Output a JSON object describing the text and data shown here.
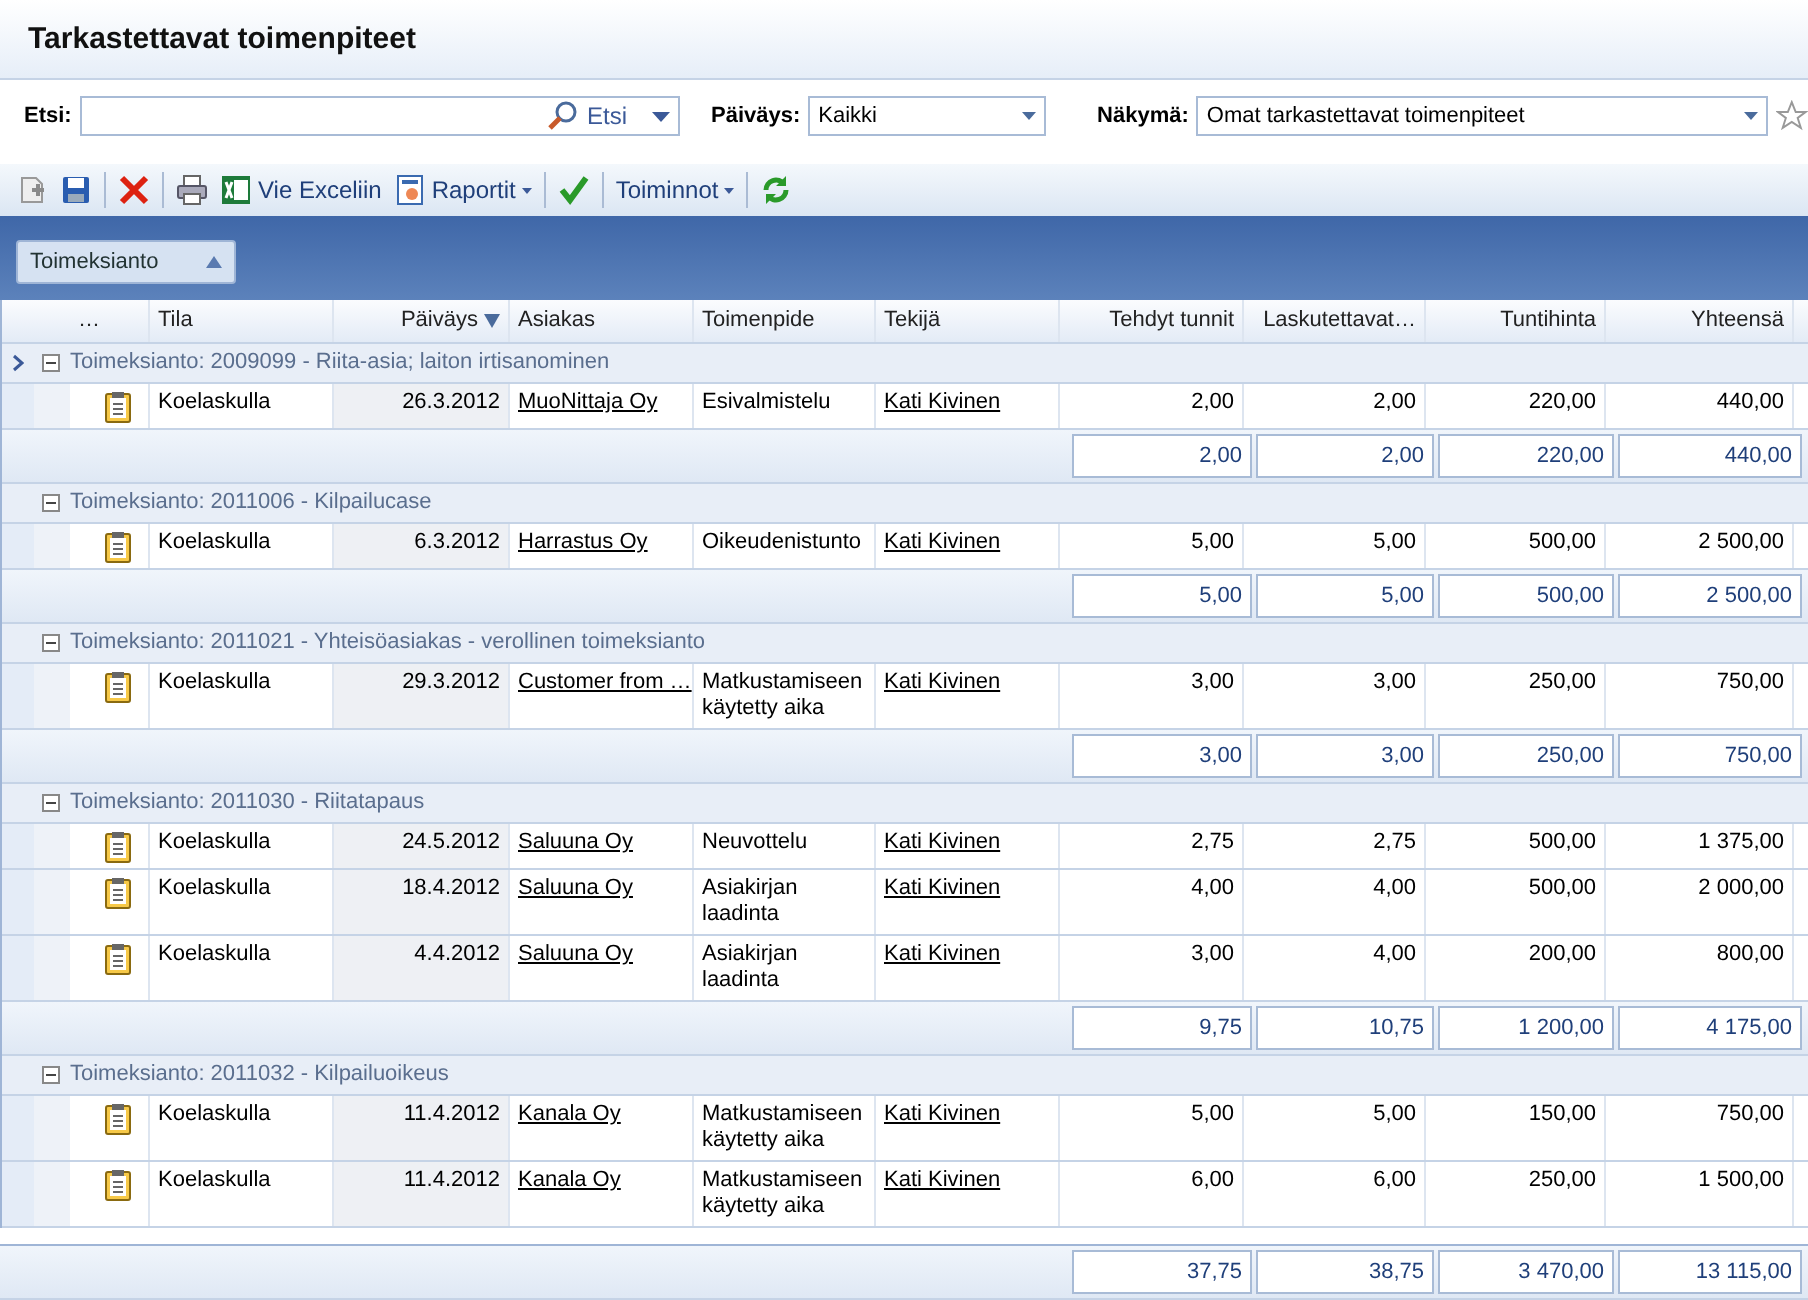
{
  "window": {
    "title": "Tarkastettavat toimenpiteet"
  },
  "filters": {
    "search": {
      "label": "Etsi:",
      "button": "Etsi"
    },
    "date": {
      "label": "Päiväys:",
      "value": "Kaikki"
    },
    "view": {
      "label": "Näkymä:",
      "value": "Omat tarkastettavat toimenpiteet"
    }
  },
  "toolbar": [
    {
      "kind": "add"
    },
    {
      "kind": "save"
    },
    {
      "kind": "separator"
    },
    {
      "kind": "delete"
    },
    {
      "kind": "separator"
    },
    {
      "kind": "print"
    },
    {
      "kind": "export",
      "label": "Vie Exceliin"
    },
    {
      "kind": "report",
      "label": "Raportit"
    },
    {
      "kind": "separator"
    },
    {
      "kind": "approve"
    },
    {
      "kind": "separator"
    },
    {
      "kind": "actions",
      "label": "Toiminnot"
    },
    {
      "kind": "separator"
    },
    {
      "kind": "refresh"
    }
  ],
  "group_panel": {
    "label": "Toimeksianto"
  },
  "table": {
    "columns": [
      {
        "label": "…"
      },
      {
        "label": "Tila"
      },
      {
        "label": "Päiväys",
        "sorted": true
      },
      {
        "label": "Asiakas"
      },
      {
        "label": "Toimenpide"
      },
      {
        "label": "Tekijä"
      },
      {
        "label": "Tehdyt tunnit"
      },
      {
        "label": "Laskutettavat…"
      },
      {
        "label": "Tuntihinta"
      },
      {
        "label": "Yhteensä"
      }
    ],
    "groups": [
      {
        "title": "Toimeksianto: 2009099 - Riita-asia; laiton irtisanominen",
        "expanded": true,
        "selected": true,
        "rows": [
          {
            "status": "Koelaskulla",
            "date": "26.3.2012",
            "customer": "MuoNittaja Oy",
            "action": "Esivalmistelu",
            "author": "Kati Kivinen",
            "hours": "2,00",
            "billable": "2,00",
            "rate": "220,00",
            "total": "440,00"
          }
        ],
        "summary": [
          "2,00",
          "2,00",
          "220,00",
          "440,00"
        ]
      },
      {
        "title": "Toimeksianto: 2011006 - Kilpailucase",
        "expanded": true,
        "selected": false,
        "rows": [
          {
            "status": "Koelaskulla",
            "date": "6.3.2012",
            "customer": "Harrastus Oy",
            "action": "Oikeudenistunto",
            "author": "Kati Kivinen",
            "hours": "5,00",
            "billable": "5,00",
            "rate": "500,00",
            "total": "2 500,00"
          }
        ],
        "summary": [
          "5,00",
          "5,00",
          "500,00",
          "2 500,00"
        ]
      },
      {
        "title": "Toimeksianto: 2011021 - Yhteisöasiakas - verollinen toimeksianto",
        "expanded": true,
        "selected": false,
        "rows": [
          {
            "status": "Koelaskulla",
            "date": "29.3.2012",
            "customer": "Customer from …",
            "action": "Matkustamiseen käytetty aika",
            "author": "Kati Kivinen",
            "hours": "3,00",
            "billable": "3,00",
            "rate": "250,00",
            "total": "750,00"
          }
        ],
        "summary": [
          "3,00",
          "3,00",
          "250,00",
          "750,00"
        ]
      },
      {
        "title": "Toimeksianto: 2011030 - Riitatapaus",
        "expanded": true,
        "selected": false,
        "rows": [
          {
            "status": "Koelaskulla",
            "date": "24.5.2012",
            "customer": "Saluuna Oy",
            "action": "Neuvottelu",
            "author": "Kati Kivinen",
            "hours": "2,75",
            "billable": "2,75",
            "rate": "500,00",
            "total": "1 375,00"
          },
          {
            "status": "Koelaskulla",
            "date": "18.4.2012",
            "customer": "Saluuna Oy",
            "action": "Asiakirjan laadinta",
            "author": "Kati Kivinen",
            "hours": "4,00",
            "billable": "4,00",
            "rate": "500,00",
            "total": "2 000,00"
          },
          {
            "status": "Koelaskulla",
            "date": "4.4.2012",
            "customer": "Saluuna Oy",
            "action": "Asiakirjan laadinta",
            "author": "Kati Kivinen",
            "hours": "3,00",
            "billable": "4,00",
            "rate": "200,00",
            "total": "800,00"
          }
        ],
        "summary": [
          "9,75",
          "10,75",
          "1 200,00",
          "4 175,00"
        ]
      },
      {
        "title": "Toimeksianto: 2011032 - Kilpailuoikeus",
        "expanded": true,
        "selected": false,
        "rows": [
          {
            "status": "Koelaskulla",
            "date": "11.4.2012",
            "customer": "Kanala Oy",
            "action": "Matkustamiseen käytetty aika",
            "author": "Kati Kivinen",
            "hours": "5,00",
            "billable": "5,00",
            "rate": "150,00",
            "total": "750,00"
          },
          {
            "status": "Koelaskulla",
            "date": "11.4.2012",
            "customer": "Kanala Oy",
            "action": "Matkustamiseen käytetty aika",
            "author": "Kati Kivinen",
            "hours": "6,00",
            "billable": "6,00",
            "rate": "250,00",
            "total": "1 500,00"
          }
        ]
      }
    ],
    "totals": [
      "37,75",
      "38,75",
      "3 470,00",
      "13 115,00"
    ]
  }
}
